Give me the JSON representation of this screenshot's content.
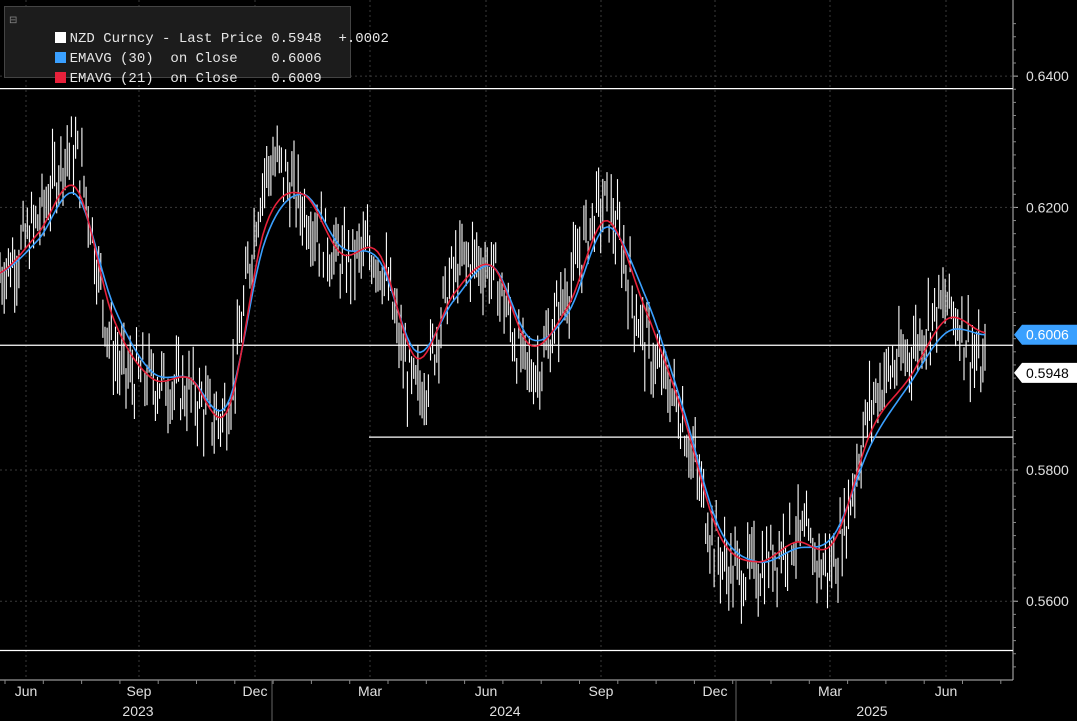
{
  "legend": {
    "rows": [
      {
        "text": "NZD Curncy - Last Price 0.5948  +.0002",
        "color": "#ffffff"
      },
      {
        "text": "EMAVG (30)  on Close    0.6006",
        "color": "#3aa0ff"
      },
      {
        "text": "EMAVG (21)  on Close    0.6009",
        "color": "#e8213b"
      }
    ]
  },
  "chart_data": {
    "type": "line",
    "title": "NZD Curncy - Last Price 0.5948 +.0002",
    "ylim": [
      0.548,
      0.6516
    ],
    "y_ticks": [
      "0.6400",
      "0.6200",
      "0.5800",
      "0.5600"
    ],
    "x_ticks": [
      "Jun",
      "Sep",
      "Dec",
      "Mar",
      "Jun",
      "Sep",
      "Dec",
      "Mar",
      "Jun"
    ],
    "year_labels": [
      "2023",
      "2024",
      "2025"
    ],
    "last_labels": {
      "ema": "0.6006",
      "price": "0.5948"
    },
    "hlines": [
      0.6381,
      0.599,
      0.585,
      0.5525
    ],
    "series": [
      {
        "name": "NZD Curncy - Last Price",
        "color": "#ffffff",
        "x": [
          "2023-05",
          "2023-06",
          "2023-07",
          "2023-08",
          "2023-09",
          "2023-10",
          "2023-11",
          "2023-12",
          "2024-01",
          "2024-02",
          "2024-03",
          "2024-04",
          "2024-05",
          "2024-06",
          "2024-07",
          "2024-08",
          "2024-09",
          "2024-10",
          "2024-11",
          "2024-12",
          "2025-01",
          "2025-02",
          "2025-03",
          "2025-04",
          "2025-05",
          "2025-06",
          "2025-07"
        ],
        "values": [
          0.61,
          0.618,
          0.628,
          0.598,
          0.594,
          0.592,
          0.59,
          0.625,
          0.62,
          0.612,
          0.612,
          0.592,
          0.61,
          0.61,
          0.595,
          0.608,
          0.62,
          0.6,
          0.588,
          0.567,
          0.565,
          0.57,
          0.566,
          0.59,
          0.598,
          0.605,
          0.5948
        ]
      },
      {
        "name": "EMAVG (30) on Close",
        "color": "#3aa0ff",
        "x": [
          "2023-05",
          "2023-06",
          "2023-07",
          "2023-08",
          "2023-09",
          "2023-10",
          "2023-11",
          "2023-12",
          "2024-01",
          "2024-02",
          "2024-03",
          "2024-04",
          "2024-05",
          "2024-06",
          "2024-07",
          "2024-08",
          "2024-09",
          "2024-10",
          "2024-11",
          "2024-12",
          "2025-01",
          "2025-02",
          "2025-03",
          "2025-04",
          "2025-05",
          "2025-06",
          "2025-07"
        ],
        "values": [
          0.61,
          0.615,
          0.622,
          0.605,
          0.595,
          0.594,
          0.59,
          0.615,
          0.622,
          0.614,
          0.612,
          0.598,
          0.606,
          0.611,
          0.6,
          0.604,
          0.617,
          0.607,
          0.59,
          0.571,
          0.566,
          0.568,
          0.57,
          0.584,
          0.593,
          0.601,
          0.6006
        ]
      },
      {
        "name": "EMAVG (21) on Close",
        "color": "#e8213b",
        "x": [
          "2023-05",
          "2023-06",
          "2023-07",
          "2023-08",
          "2023-09",
          "2023-10",
          "2023-11",
          "2023-12",
          "2024-01",
          "2024-02",
          "2024-03",
          "2024-04",
          "2024-05",
          "2024-06",
          "2024-07",
          "2024-08",
          "2024-09",
          "2024-10",
          "2024-11",
          "2024-12",
          "2025-01",
          "2025-02",
          "2025-03",
          "2025-04",
          "2025-05",
          "2025-06",
          "2025-07"
        ],
        "values": [
          0.61,
          0.616,
          0.623,
          0.603,
          0.594,
          0.594,
          0.589,
          0.617,
          0.622,
          0.613,
          0.613,
          0.597,
          0.607,
          0.611,
          0.599,
          0.605,
          0.618,
          0.605,
          0.589,
          0.57,
          0.566,
          0.569,
          0.569,
          0.586,
          0.594,
          0.603,
          0.6009
        ]
      }
    ]
  }
}
